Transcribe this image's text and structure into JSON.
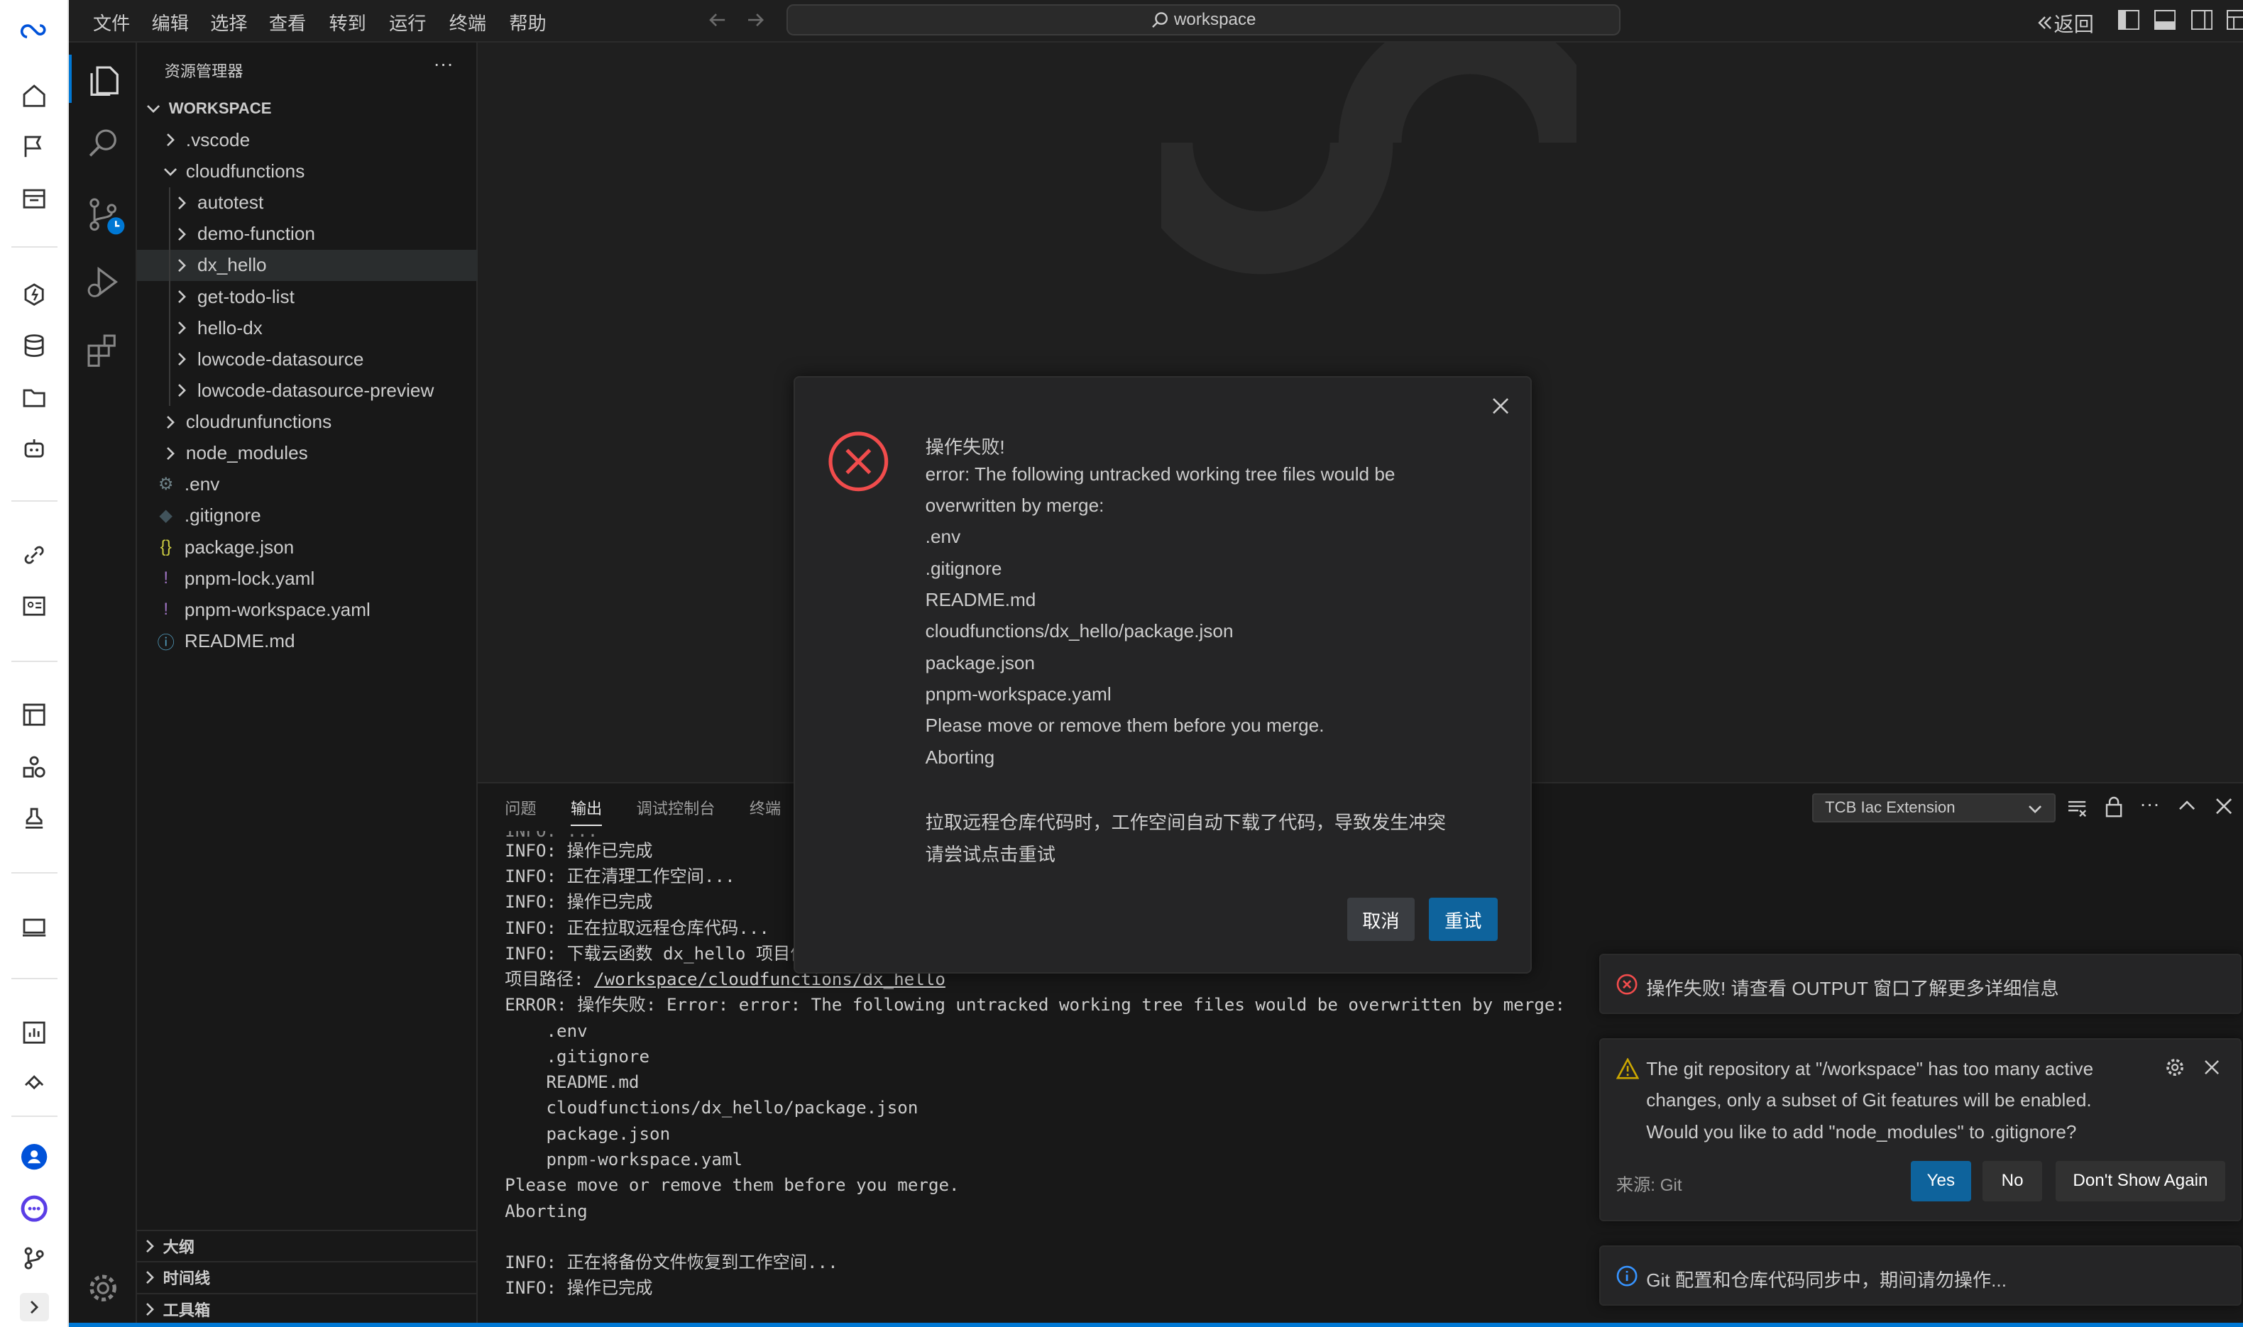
{
  "menubar": {
    "items": [
      "文件",
      "编辑",
      "选择",
      "查看",
      "转到",
      "运行",
      "终端",
      "帮助"
    ],
    "search_text": "workspace",
    "back_label": "返回"
  },
  "explorer": {
    "title": "资源管理器",
    "workspace_label": "WORKSPACE",
    "tree": [
      {
        "label": ".vscode",
        "kind": "folder",
        "level": 1,
        "expanded": false
      },
      {
        "label": "cloudfunctions",
        "kind": "folder",
        "level": 1,
        "expanded": true
      },
      {
        "label": "autotest",
        "kind": "folder",
        "level": 2,
        "expanded": false
      },
      {
        "label": "demo-function",
        "kind": "folder",
        "level": 2,
        "expanded": false
      },
      {
        "label": "dx_hello",
        "kind": "folder",
        "level": 2,
        "expanded": false,
        "selected": true
      },
      {
        "label": "get-todo-list",
        "kind": "folder",
        "level": 2,
        "expanded": false
      },
      {
        "label": "hello-dx",
        "kind": "folder",
        "level": 2,
        "expanded": false
      },
      {
        "label": "lowcode-datasource",
        "kind": "folder",
        "level": 2,
        "expanded": false
      },
      {
        "label": "lowcode-datasource-preview",
        "kind": "folder",
        "level": 2,
        "expanded": false
      },
      {
        "label": "cloudrunfunctions",
        "kind": "folder",
        "level": 1,
        "expanded": false
      },
      {
        "label": "node_modules",
        "kind": "folder",
        "level": 1,
        "expanded": false
      },
      {
        "label": ".env",
        "kind": "file",
        "icon": "gear-icon",
        "glyph": "⚙",
        "color": "#6d8086"
      },
      {
        "label": ".gitignore",
        "kind": "file",
        "icon": "git-file-icon",
        "glyph": "◆",
        "color": "#41535b"
      },
      {
        "label": "package.json",
        "kind": "file",
        "icon": "json-icon",
        "glyph": "{}",
        "color": "#cbcb41"
      },
      {
        "label": "pnpm-lock.yaml",
        "kind": "file",
        "icon": "yaml-icon",
        "glyph": "!",
        "color": "#a074c4"
      },
      {
        "label": "pnpm-workspace.yaml",
        "kind": "file",
        "icon": "yaml-icon",
        "glyph": "!",
        "color": "#a074c4"
      },
      {
        "label": "README.md",
        "kind": "file",
        "icon": "info-icon",
        "glyph": "ⓘ",
        "color": "#519aba"
      }
    ],
    "sections": [
      "大纲",
      "时间线",
      "工具箱"
    ]
  },
  "panel": {
    "tabs": [
      "问题",
      "输出",
      "调试控制台",
      "终端"
    ],
    "active_tab": "输出",
    "channel": "TCB Iac Extension",
    "output_lines": [
      "INFO: 操作已完成",
      "INFO: 正在清理工作空间...",
      "INFO: 操作已完成",
      "INFO: 正在拉取远程仓库代码...",
      "INFO: 下载云函数 dx_hello 项目信",
      "项目路径: ",
      "ERROR: 操作失败: Error: error: The following untracked working tree files would be overwritten by merge:",
      "    .env",
      "    .gitignore",
      "    README.md",
      "    cloudfunctions/dx_hello/package.json",
      "    package.json",
      "    pnpm-workspace.yaml",
      "Please move or remove them before you merge.",
      "Aborting",
      "",
      "INFO: 正在将备份文件恢复到工作空间...",
      "INFO: 操作已完成"
    ],
    "path_link": "/workspace/cloudfunctions/dx_hello"
  },
  "modal": {
    "lines": [
      "操作失败!",
      "error: The following untracked working tree files would be",
      "overwritten by merge:",
      ".env",
      ".gitignore",
      "README.md",
      "cloudfunctions/dx_hello/package.json",
      "package.json",
      "pnpm-workspace.yaml",
      "Please move or remove them before you merge.",
      "Aborting",
      "",
      "拉取远程仓库代码时，工作空间自动下载了代码，导致发生冲突",
      "请尝试点击重试"
    ],
    "cancel_label": "取消",
    "retry_label": "重试"
  },
  "toasts": {
    "error": "操作失败! 请查看 OUTPUT 窗口了解更多详细信息",
    "git_lines": [
      "The git repository at \"/workspace\" has too many active",
      "changes, only a subset of Git features will be enabled.",
      "Would you like to add \"node_modules\" to .gitignore?"
    ],
    "git_source": "来源: Git",
    "yes_label": "Yes",
    "no_label": "No",
    "dont_show_label": "Don't Show Again",
    "info": "Git 配置和仓库代码同步中，期间请勿操作..."
  },
  "colors": {
    "accent": "#0e639c",
    "error": "#f14c4c",
    "warning": "#cca700",
    "info": "#3794ff"
  }
}
